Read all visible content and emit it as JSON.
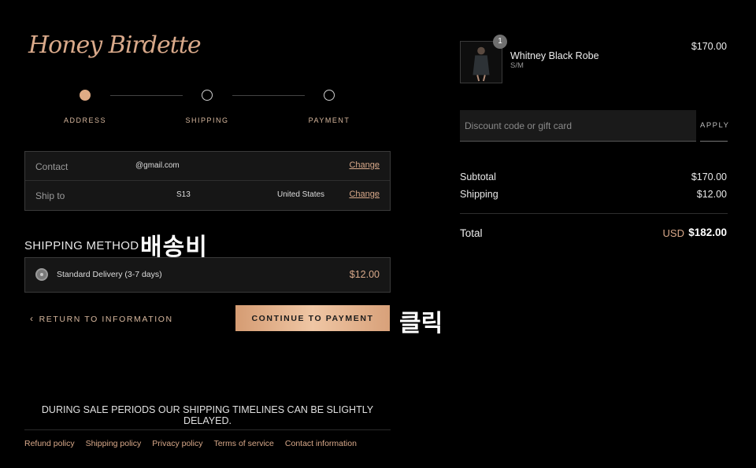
{
  "brand": {
    "logo_text": "Honey Birdette"
  },
  "steps": [
    {
      "label": "ADDRESS",
      "state": "complete"
    },
    {
      "label": "SHIPPING",
      "state": "pending"
    },
    {
      "label": "PAYMENT",
      "state": "pending"
    }
  ],
  "review": {
    "contact": {
      "label": "Contact",
      "value": "@gmail.com",
      "action": "Change"
    },
    "ship_to": {
      "label": "Ship to",
      "address": "S13",
      "country": "United States",
      "action": "Change"
    }
  },
  "shipping_method": {
    "title": "SHIPPING METHOD",
    "annotation": "배송비",
    "option": {
      "name": "Standard Delivery (3-7 days)",
      "price": "$12.00",
      "selected": true
    }
  },
  "actions": {
    "return_label": "RETURN TO INFORMATION",
    "continue_label": "CONTINUE TO PAYMENT",
    "annotation": "클릭"
  },
  "notice": "DURING SALE PERIODS OUR SHIPPING TIMELINES CAN BE SLIGHTLY DELAYED.",
  "footer_links": [
    "Refund policy",
    "Shipping policy",
    "Privacy policy",
    "Terms of service",
    "Contact information"
  ],
  "cart": {
    "item": {
      "name": "Whitney Black Robe",
      "variant": "S/M",
      "price": "$170.00",
      "quantity": "1"
    },
    "discount": {
      "placeholder": "Discount code or gift card",
      "button": "APPLY"
    },
    "summary": {
      "subtotal_label": "Subtotal",
      "subtotal_value": "$170.00",
      "shipping_label": "Shipping",
      "shipping_value": "$12.00",
      "total_label": "Total",
      "currency": "USD",
      "total_value": "$182.00"
    }
  },
  "colors": {
    "accent": "#d9a98a",
    "background": "#000000",
    "panel": "#161616"
  }
}
